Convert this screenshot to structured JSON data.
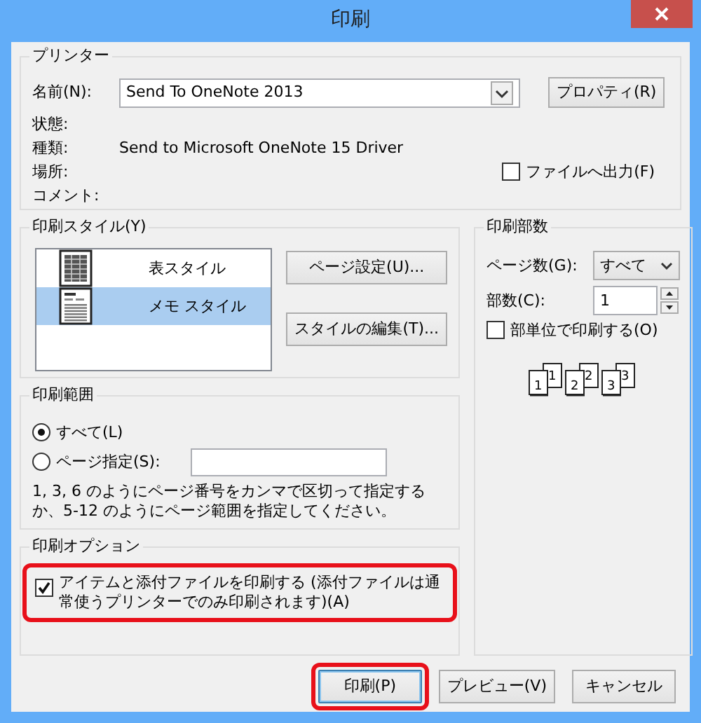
{
  "window": {
    "title": "印刷"
  },
  "printer": {
    "legend": "プリンター",
    "name_label": "名前(N):",
    "name_value": "Send To OneNote 2013",
    "properties_button": "プロパティ(R)",
    "status_label": "状態:",
    "type_label": "種類:",
    "type_value": "Send to Microsoft OneNote 15 Driver",
    "where_label": "場所:",
    "comment_label": "コメント:",
    "print_to_file": {
      "label": "ファイルへ出力(F)",
      "checked": false
    }
  },
  "print_style": {
    "legend": "印刷スタイル(Y)",
    "styles": [
      {
        "label": "表スタイル",
        "kind": "table",
        "selected": false
      },
      {
        "label": "メモ スタイル",
        "kind": "memo",
        "selected": true
      }
    ],
    "buttons": [
      "ページ設定(U)...",
      "スタイルの編集(T)..."
    ]
  },
  "print_range": {
    "legend": "印刷範囲",
    "options": [
      {
        "label": "すべて(L)",
        "selected": true
      },
      {
        "label": "ページ指定(S):",
        "selected": false
      }
    ],
    "hint": "1, 3, 6 のようにページ番号をカンマで区切って指定するか、5-12 のようにページ範囲を指定してください。"
  },
  "print_options": {
    "legend": "印刷オプション",
    "attachments": {
      "label": "アイテムと添付ファイルを印刷する (添付ファイルは通常使うプリンターでのみ印刷されます)(A)",
      "checked": true,
      "highlighted": true
    }
  },
  "copies": {
    "legend": "印刷部数",
    "pages_label": "ページ数(G):",
    "pages_value": "すべて",
    "copies_label": "部数(C):",
    "copies_value": "1",
    "collate": {
      "label": "部単位で印刷する(O)",
      "checked": false
    },
    "collate_pages": [
      "1",
      "1",
      "2",
      "2",
      "3",
      "3"
    ]
  },
  "buttons": [
    {
      "label": "印刷(P)",
      "default": true,
      "highlighted": true
    },
    {
      "label": "プレビュー(V)",
      "default": false,
      "highlighted": false
    },
    {
      "label": "キャンセル",
      "default": false,
      "highlighted": false
    }
  ]
}
